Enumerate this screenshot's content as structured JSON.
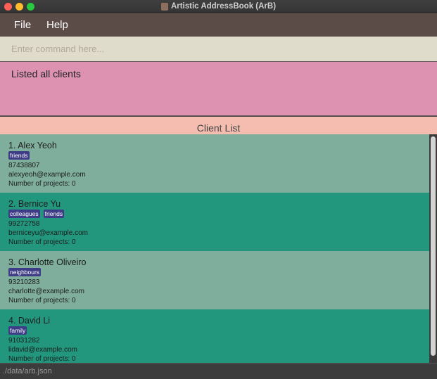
{
  "window": {
    "title": "Artistic AddressBook (ArB)"
  },
  "menu": {
    "file": "File",
    "help": "Help"
  },
  "command": {
    "placeholder": "Enter command here...",
    "value": ""
  },
  "result": {
    "text": "Listed all clients"
  },
  "list": {
    "header": "Client List",
    "clients": [
      {
        "name": "1.  Alex Yeoh",
        "tags": [
          "friends"
        ],
        "phone": "87438807",
        "email": "alexyeoh@example.com",
        "projects": "Number of projects: 0"
      },
      {
        "name": "2.  Bernice Yu",
        "tags": [
          "colleagues",
          "friends"
        ],
        "phone": "99272758",
        "email": "berniceyu@example.com",
        "projects": "Number of projects: 0"
      },
      {
        "name": "3.  Charlotte Oliveiro",
        "tags": [
          "neighbours"
        ],
        "phone": "93210283",
        "email": "charlotte@example.com",
        "projects": "Number of projects: 0"
      },
      {
        "name": "4.  David Li",
        "tags": [
          "family"
        ],
        "phone": "91031282",
        "email": "lidavid@example.com",
        "projects": "Number of projects: 0"
      }
    ]
  },
  "status": {
    "path": "./data/arb.json"
  },
  "colors": {
    "card_light": "#7fae9d",
    "card_dark": "#22977e",
    "tag": "#3e3c86",
    "result_bg": "#dc92b0",
    "header_bg": "#f5bdb0",
    "menubar": "#5b4c47"
  }
}
